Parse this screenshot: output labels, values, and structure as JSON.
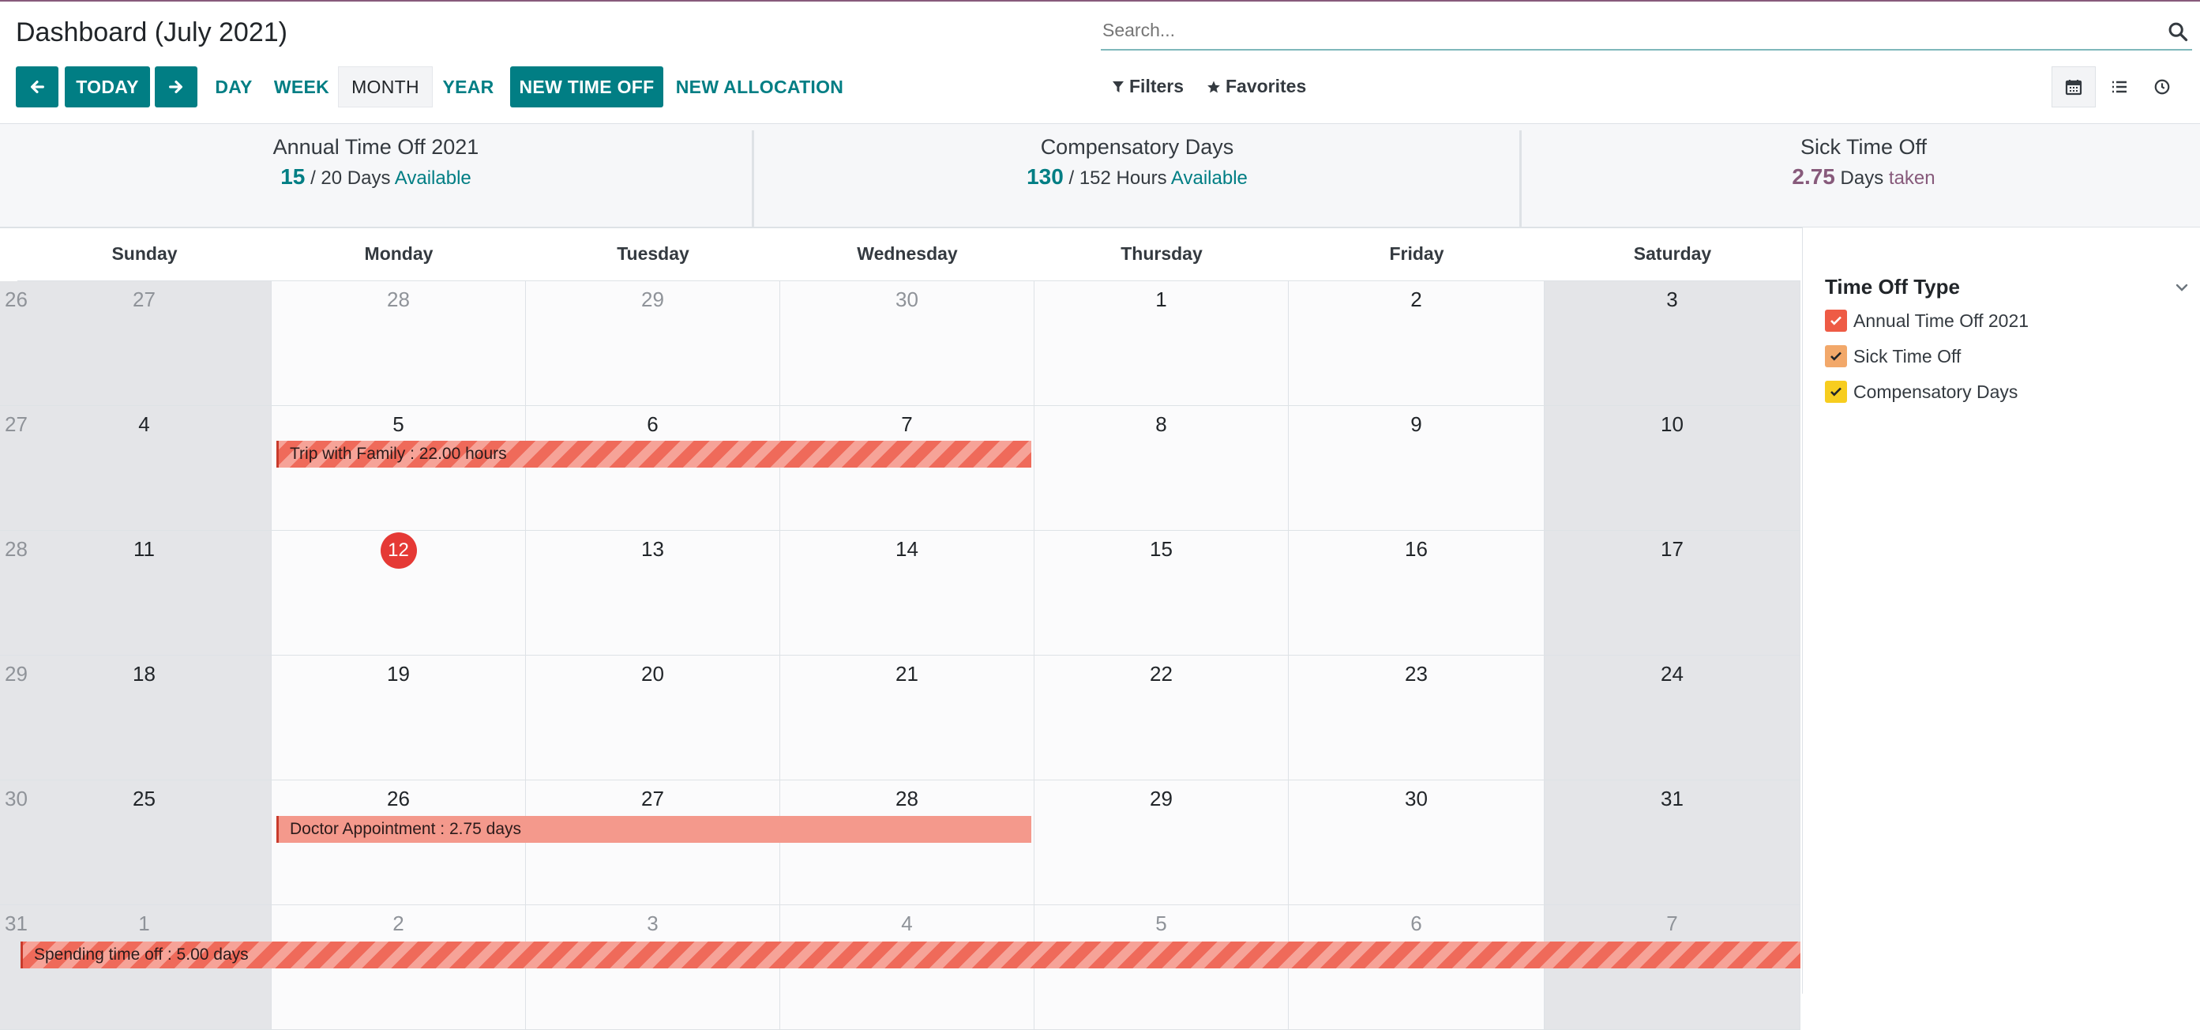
{
  "header": {
    "title": "Dashboard (July 2021)",
    "today_label": "TODAY",
    "day_label": "DAY",
    "week_label": "WEEK",
    "month_label": "MONTH",
    "year_label": "YEAR",
    "new_time_off_label": "NEW TIME OFF",
    "new_allocation_label": "NEW ALLOCATION"
  },
  "search": {
    "placeholder": "Search..."
  },
  "filters": {
    "filters_label": "Filters",
    "favorites_label": "Favorites"
  },
  "stats": [
    {
      "name": "Annual Time Off 2021",
      "value": "15",
      "total": "/ 20 Days",
      "status": "Available"
    },
    {
      "name": "Compensatory Days",
      "value": "130",
      "total": "/ 152 Hours",
      "status": "Available"
    },
    {
      "name": "Sick Time Off",
      "value": "2.75",
      "unit": "Days",
      "status": "taken"
    }
  ],
  "calendar": {
    "days": [
      "Sunday",
      "Monday",
      "Tuesday",
      "Wednesday",
      "Thursday",
      "Friday",
      "Saturday"
    ],
    "weeks": [
      {
        "week": "26",
        "dates": [
          "27",
          "28",
          "29",
          "30",
          "1",
          "2",
          "3"
        ],
        "muted": [
          true,
          true,
          true,
          true,
          false,
          false,
          false
        ]
      },
      {
        "week": "27",
        "dates": [
          "4",
          "5",
          "6",
          "7",
          "8",
          "9",
          "10"
        ],
        "muted": [
          false,
          false,
          false,
          false,
          false,
          false,
          false
        ]
      },
      {
        "week": "28",
        "dates": [
          "11",
          "12",
          "13",
          "14",
          "15",
          "16",
          "17"
        ],
        "muted": [
          false,
          false,
          false,
          false,
          false,
          false,
          false
        ]
      },
      {
        "week": "29",
        "dates": [
          "18",
          "19",
          "20",
          "21",
          "22",
          "23",
          "24"
        ],
        "muted": [
          false,
          false,
          false,
          false,
          false,
          false,
          false
        ]
      },
      {
        "week": "30",
        "dates": [
          "25",
          "26",
          "27",
          "28",
          "29",
          "30",
          "31"
        ],
        "muted": [
          false,
          false,
          false,
          false,
          false,
          false,
          false
        ]
      },
      {
        "week": "31",
        "dates": [
          "1",
          "2",
          "3",
          "4",
          "5",
          "6",
          "7"
        ],
        "muted": [
          true,
          true,
          true,
          true,
          true,
          true,
          true
        ]
      }
    ],
    "today": "12",
    "events": [
      {
        "label": "Trip with Family : 22.00 hours",
        "style": "striped"
      },
      {
        "label": "Doctor Appointment : 2.75 days",
        "style": "solid"
      },
      {
        "label": "Spending time off : 5.00 days",
        "style": "striped"
      }
    ]
  },
  "sidepanel": {
    "title": "Time Off Type",
    "items": [
      {
        "label": "Annual Time Off 2021",
        "color": "#ee5b45"
      },
      {
        "label": "Sick Time Off",
        "color": "#f2a86a"
      },
      {
        "label": "Compensatory Days",
        "color": "#f7cd1f"
      }
    ]
  }
}
